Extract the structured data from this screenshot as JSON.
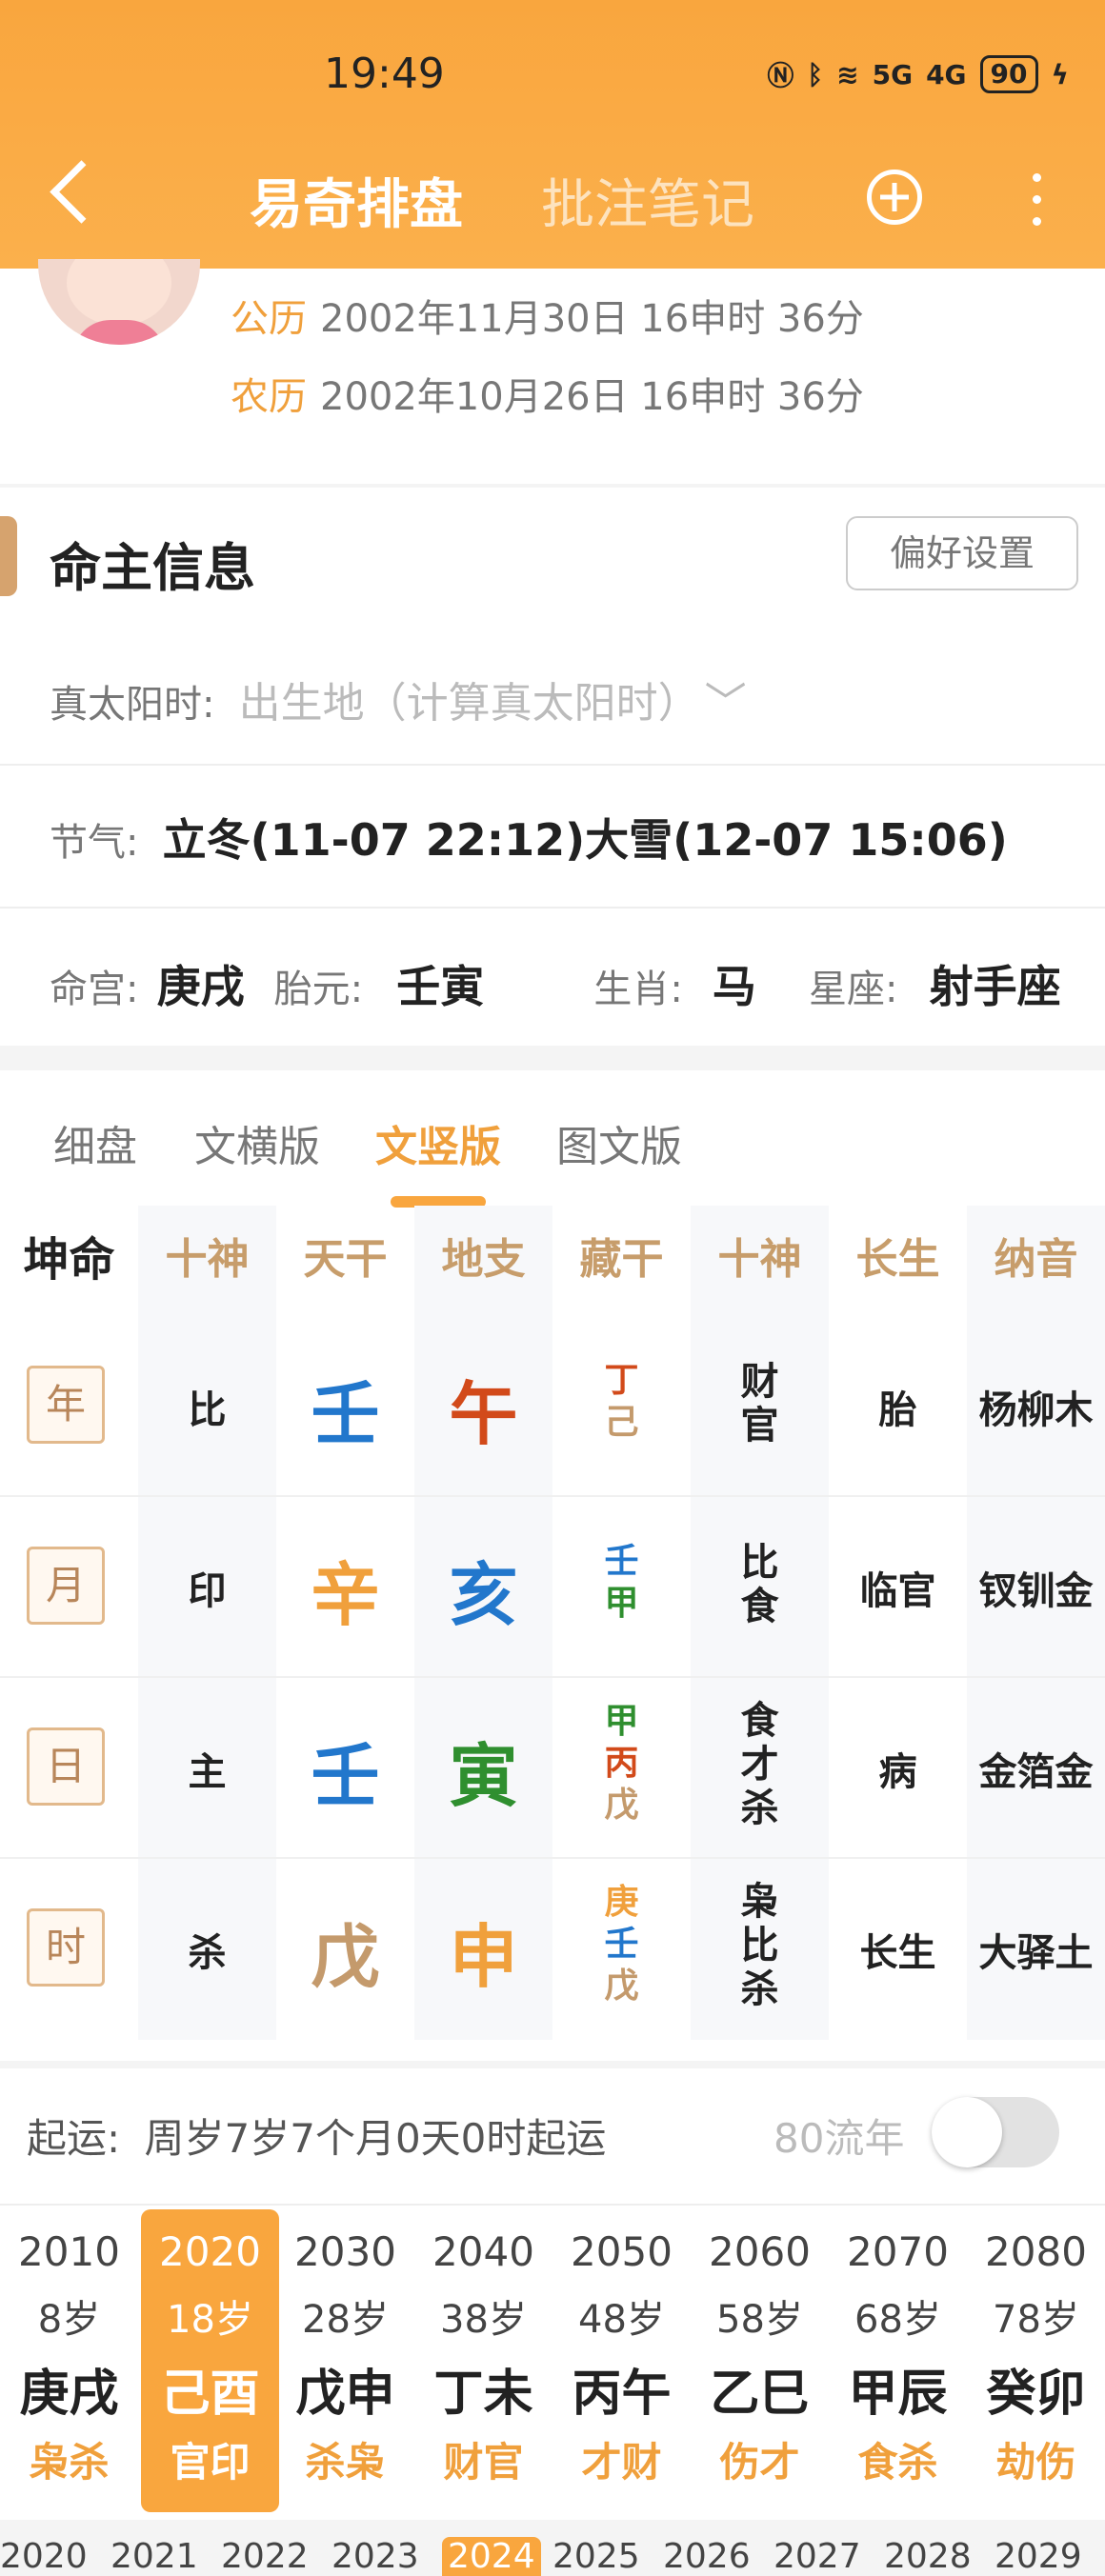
{
  "status": {
    "time": "19:49",
    "battery": "90",
    "net1": "5G",
    "net2": "4G"
  },
  "nav": {
    "tab_active": "易奇排盘",
    "tab_other": "批注笔记"
  },
  "profile": {
    "solar_label": "公历",
    "solar_value": "2002年11月30日 16申时 36分",
    "lunar_label": "农历",
    "lunar_value": "2002年10月26日 16申时 36分"
  },
  "info": {
    "title": "命主信息",
    "pref_button": "偏好设置",
    "true_sun_label": "真太阳时:",
    "true_sun_placeholder": "出生地（计算真太阳时）",
    "jieqi_label": "节气:",
    "jieqi_value": "立冬(11-07 22:12)大雪(12-07 15:06)",
    "minggong_label": "命宫:",
    "minggong_value": "庚戌",
    "taiyuan_label": "胎元:",
    "taiyuan_value": "壬寅",
    "shengxiao_label": "生肖:",
    "shengxiao_value": "马",
    "xingzuo_label": "星座:",
    "xingzuo_value": "射手座"
  },
  "subtabs": [
    "细盘",
    "文横版",
    "文竖版",
    "图文版"
  ],
  "table": {
    "corner": "坤命",
    "headers": [
      "十神",
      "天干",
      "地支",
      "藏干",
      "十神",
      "长生",
      "纳音"
    ],
    "rows": [
      {
        "pillar": "年",
        "shishen": "比",
        "gan": "壬",
        "zhi": "午",
        "canggan": [
          "丁",
          "己"
        ],
        "shishen2": [
          "财",
          "官"
        ],
        "changsheng": "胎",
        "nayin": "杨柳木"
      },
      {
        "pillar": "月",
        "shishen": "印",
        "gan": "辛",
        "zhi": "亥",
        "canggan": [
          "壬",
          "甲"
        ],
        "shishen2": [
          "比",
          "食"
        ],
        "changsheng": "临官",
        "nayin": "钗钏金"
      },
      {
        "pillar": "日",
        "shishen": "主",
        "gan": "壬",
        "zhi": "寅",
        "canggan": [
          "甲",
          "丙",
          "戊"
        ],
        "shishen2": [
          "食",
          "才",
          "杀"
        ],
        "changsheng": "病",
        "nayin": "金箔金"
      },
      {
        "pillar": "时",
        "shishen": "杀",
        "gan": "戊",
        "zhi": "申",
        "canggan": [
          "庚",
          "壬",
          "戊"
        ],
        "shishen2": [
          "枭",
          "比",
          "杀"
        ],
        "changsheng": "长生",
        "nayin": "大驿土"
      }
    ]
  },
  "colors": {
    "water": "#2277cc",
    "fire": "#d24a1a",
    "metal": "#f0a03c",
    "wood": "#2f8f2f",
    "earth": "#c49a6c",
    "accent": "#f9a63e"
  },
  "luck": {
    "qiyun_label": "起运:",
    "qiyun_value": "周岁7岁7个月0天0时起运",
    "liunian_label": "80流年",
    "dayun": [
      {
        "year": "2010",
        "age": "8岁",
        "ganzhi": "庚戌",
        "shishen": "枭杀"
      },
      {
        "year": "2020",
        "age": "18岁",
        "ganzhi": "己酉",
        "shishen": "官印"
      },
      {
        "year": "2030",
        "age": "28岁",
        "ganzhi": "戊申",
        "shishen": "杀枭"
      },
      {
        "year": "2040",
        "age": "38岁",
        "ganzhi": "丁未",
        "shishen": "财官"
      },
      {
        "year": "2050",
        "age": "48岁",
        "ganzhi": "丙午",
        "shishen": "才财"
      },
      {
        "year": "2060",
        "age": "58岁",
        "ganzhi": "乙巳",
        "shishen": "伤才"
      },
      {
        "year": "2070",
        "age": "68岁",
        "ganzhi": "甲辰",
        "shishen": "食杀"
      },
      {
        "year": "2080",
        "age": "78岁",
        "ganzhi": "癸卯",
        "shishen": "劫伤"
      }
    ],
    "years_strip": [
      "2020",
      "2021",
      "2022",
      "2023",
      "2024",
      "2025",
      "2026",
      "2027",
      "2028",
      "2029"
    ]
  }
}
